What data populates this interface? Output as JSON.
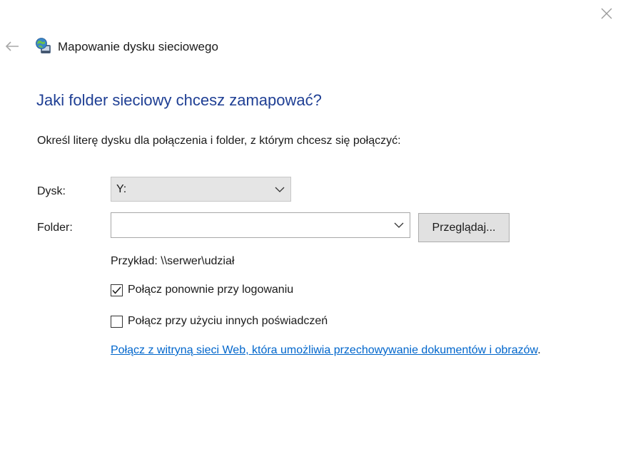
{
  "window": {
    "title": "Mapowanie dysku sieciowego",
    "title_icon": "network-drive-icon",
    "close_icon": "close-icon",
    "back_icon": "back-arrow-icon"
  },
  "main": {
    "heading": "Jaki folder sieciowy chcesz zamapować?",
    "instruction": "Określ literę dysku dla połączenia i folder, z którym chcesz się połączyć:",
    "drive": {
      "label": "Dysk:",
      "value": "Y:"
    },
    "folder": {
      "label": "Folder:",
      "value": "",
      "placeholder": ""
    },
    "browse_label": "Przeglądaj...",
    "example": "Przykład: \\\\serwer\\udział",
    "reconnect": {
      "label": "Połącz ponownie przy logowaniu",
      "checked": true
    },
    "other_credentials": {
      "label": "Połącz przy użyciu innych poświadczeń",
      "checked": false
    },
    "web_link": {
      "text": "Połącz z witryną sieci Web, która umożliwia przechowywanie dokumentów i obrazów",
      "suffix": "."
    }
  },
  "colors": {
    "heading": "#1f3f94",
    "link": "#0066cc",
    "select_bg": "#e5e5e5",
    "button_bg": "#e1e1e1"
  }
}
